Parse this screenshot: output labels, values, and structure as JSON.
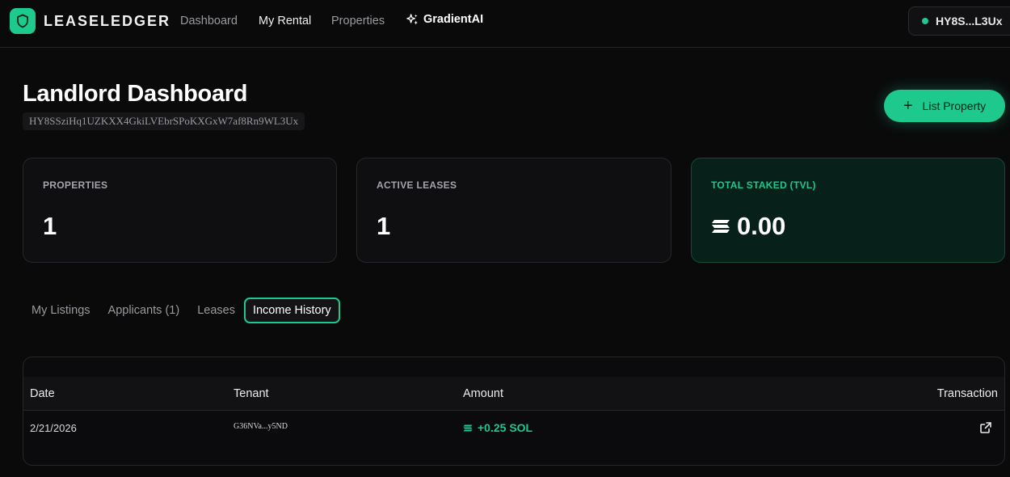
{
  "nav": {
    "brand": "LEASELEDGER",
    "links": [
      "Dashboard",
      "My Rental",
      "Properties"
    ],
    "ai_link": "GradientAI",
    "wallet_short": "HY8S...L3Ux"
  },
  "header": {
    "title": "Landlord Dashboard",
    "wallet_full": "HY8SSziHq1UZKXX4GkiLVEbrSPoKXGxW7af8Rn9WL3Ux",
    "list_button": "List Property"
  },
  "stats": [
    {
      "label": "PROPERTIES",
      "value": "1"
    },
    {
      "label": "ACTIVE LEASES",
      "value": "1"
    },
    {
      "label": "TOTAL STAKED (TVL)",
      "value": "0.00"
    }
  ],
  "tabs": [
    "My Listings",
    "Applicants (1)",
    "Leases",
    "Income History"
  ],
  "active_tab": "Income History",
  "table": {
    "headers": [
      "Date",
      "Tenant",
      "Amount",
      "Transaction"
    ],
    "rows": [
      {
        "date": "2/21/2026",
        "tenant": "G36NVa...y5ND",
        "amount": "+0.25 SOL"
      }
    ]
  },
  "colors": {
    "accent": "#1dc98c",
    "background": "#0a0a0b"
  }
}
